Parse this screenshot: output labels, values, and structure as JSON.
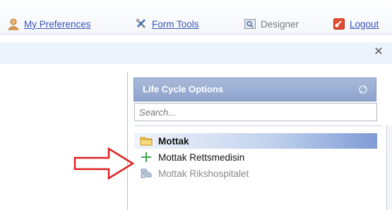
{
  "topnav": {
    "preferences_label": "My Preferences",
    "form_tools_label": "Form Tools",
    "designer_label": "Designer",
    "logout_label": "Logout"
  },
  "dialog": {
    "close_label": "✕"
  },
  "lifecycle_panel": {
    "title": "Life Cycle Options",
    "search_placeholder": "Search...",
    "items": [
      {
        "label": "Mottak",
        "icon": "folder-icon",
        "state": "selected"
      },
      {
        "label": "Mottak Rettsmedisin",
        "icon": "plus-icon",
        "state": "normal"
      },
      {
        "label": "Mottak Rikshospitalet",
        "icon": "network-icon",
        "state": "disabled"
      }
    ]
  },
  "colors": {
    "link": "#3a53b8",
    "header_bg": "#8ea3cc",
    "arrow": "#e02020"
  }
}
